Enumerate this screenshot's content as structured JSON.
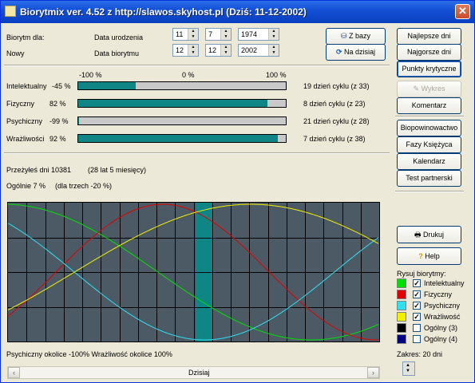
{
  "window": {
    "title": "Biorytmix ver. 4.52 z http://slawos.skyhost.pl (Dziś: 11-12-2002)"
  },
  "header": {
    "biorytm_dla_label": "Biorytm dla:",
    "name": "Nowy",
    "birth_label": "Data urodzenia",
    "bio_label": "Data biorytmu",
    "birth": {
      "day": "11",
      "month": "7",
      "year": "1974"
    },
    "bio": {
      "day": "12",
      "month": "12",
      "year": "2002"
    },
    "z_bazy": "Z bazy",
    "na_dzisiaj": "Na dzisiaj"
  },
  "scale": {
    "left": "-100 %",
    "mid": "0 %",
    "right": "100 %"
  },
  "cycles": [
    {
      "name": "Intelektualny",
      "percent": "-45 %",
      "fill": 0.275,
      "info": "19 dzień cyklu (z 33)"
    },
    {
      "name": "Fizyczny",
      "percent": "82 %",
      "fill": 0.91,
      "info": "8 dzień cyklu (z 23)"
    },
    {
      "name": "Psychiczny",
      "percent": "-99 %",
      "fill": 0.005,
      "info": "21 dzień cyklu (z 28)"
    },
    {
      "name": "Wrażliwości",
      "percent": "92 %",
      "fill": 0.96,
      "info": "7 dzień cyklu (z 38)"
    }
  ],
  "summary": {
    "lived": "Przeżyłeś dni 10381",
    "lived_detail": "(28 lat 5 miesięcy)",
    "overall": "Ogólnie 7 %",
    "overall_detail": "(dla trzech -20 %)"
  },
  "status_text": "Psychiczny okolice -100% Wrażliwość okolice 100%",
  "scroll_label": "Dzisiaj",
  "sidebar": {
    "buttons": [
      "Najlepsze dni",
      "Najgorsze dni",
      "Punkty krytyczne",
      "Wykres",
      "Komentarz",
      "Biopowinowactwo",
      "Fazy Księżyca",
      "Kalendarz",
      "Test partnerski"
    ],
    "drukuj": "Drukuj",
    "help": "Help",
    "rysuj_label": "Rysuj biorytmy:",
    "legend": [
      {
        "label": "Intelektualny",
        "color": "#00e000",
        "checked": true
      },
      {
        "label": "Fizyczny",
        "color": "#e00000",
        "checked": true
      },
      {
        "label": "Psychiczny",
        "color": "#30e0f0",
        "checked": true
      },
      {
        "label": "Wrażliwość",
        "color": "#f0f000",
        "checked": true
      },
      {
        "label": "Ogólny (3)",
        "color": "#000000",
        "checked": false
      },
      {
        "label": "Ogólny (4)",
        "color": "#000080",
        "checked": false
      }
    ],
    "zakres": "Zakres: 20 dni"
  },
  "icons": {
    "close": "close-icon",
    "database": "database-icon",
    "refresh": "refresh-icon",
    "printer": "printer-icon",
    "help": "help-icon",
    "chart": "chart-icon"
  }
}
